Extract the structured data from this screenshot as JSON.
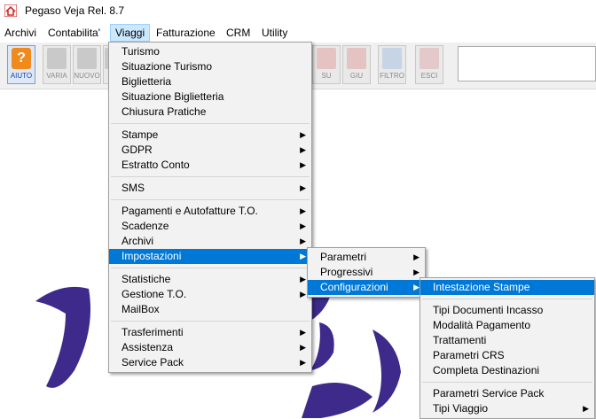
{
  "app": {
    "title": "Pegaso Veja   Rel. 8.7"
  },
  "menubar": [
    "Archivi",
    "Contabilita'",
    "Viaggi",
    "Fatturazione",
    "CRM",
    "Utility"
  ],
  "toolbar": {
    "aiuto": "AIUTO",
    "varia": "VARIA",
    "nuovo": "NUOVO",
    "su": "SU",
    "giu": "GIU",
    "filtro": "FILTRO",
    "esci": "ESCI"
  },
  "viaggi_menu": {
    "items": [
      "Turismo",
      "Situazione Turismo",
      "Biglietteria",
      "Situazione Biglietteria",
      "Chiusura Pratiche",
      "Stampe",
      "GDPR",
      "Estratto Conto",
      "SMS",
      "Pagamenti e Autofatture T.O.",
      "Scadenze",
      "Archivi",
      "Impostazioni",
      "Statistiche",
      "Gestione T.O.",
      "MailBox",
      "Trasferimenti",
      "Assistenza",
      "Service Pack"
    ]
  },
  "impostazioni_menu": {
    "items": [
      "Parametri",
      "Progressivi",
      "Configurazioni"
    ]
  },
  "configurazioni_menu": {
    "items": [
      "Intestazione Stampe",
      "Tipi Documenti Incasso",
      "Modalità Pagamento",
      "Trattamenti",
      "Parametri CRS",
      "Completa Destinazioni",
      "Parametri Service Pack",
      "Tipi Viaggio"
    ]
  },
  "colors": {
    "highlight": "#0078d7",
    "menu_bg": "#f2f2f2",
    "logo": "#3d2a8a"
  }
}
